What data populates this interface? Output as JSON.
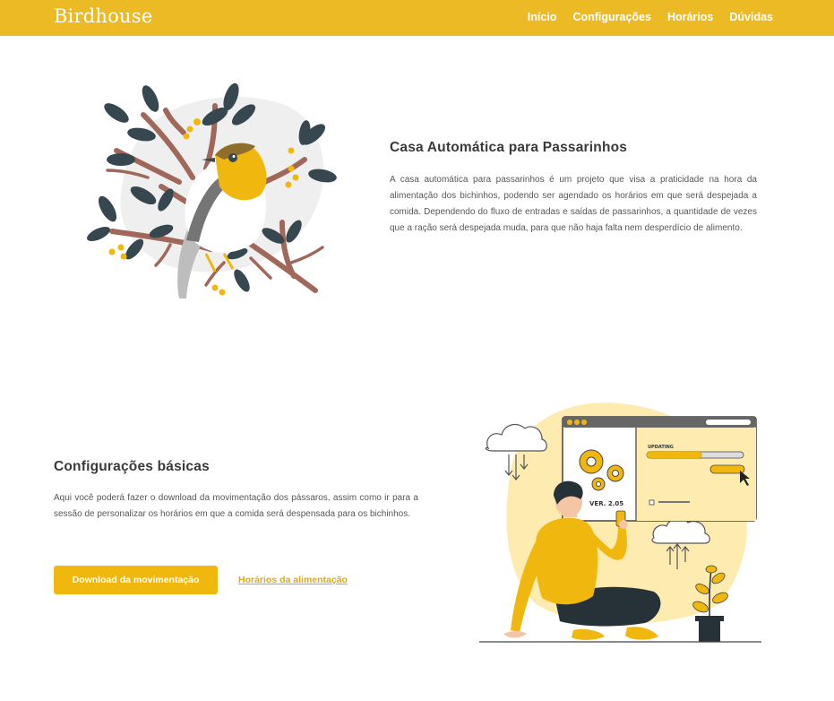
{
  "navbar": {
    "brand": "Birdhouse",
    "links": [
      "Início",
      "Configurações",
      "Horários",
      "Dúvidas"
    ]
  },
  "about": {
    "title": "Casa Automática para Passarinhos",
    "text": "A casa automática para passarinhos é um projeto que visa a praticidade na hora da alimentação dos bichinhos, podendo ser agendado os horários em que será despejada a comida. Dependendo do fluxo de entradas e saídas de passarinhos, a quantidade de vezes que a ração será despejada muda, para que não haja falta nem desperdício de alimento."
  },
  "config": {
    "title": "Configurações básicas",
    "text": "Aqui você poderá fazer o download da movimentação dos pássaros, assim como ir para a sessão de personalizar os horários em que a comida será despensada para os bichinhos.",
    "download_button": "Download da movimentação",
    "schedule_link": "Horários da alimentação"
  },
  "illustration": {
    "version_label": "VER. 2.05",
    "updating_label": "UPDATING"
  },
  "colors": {
    "accent": "#ecba24",
    "button": "#f0b70f",
    "link": "#e0a810",
    "leaf": "#37474f",
    "branch": "#a0685a"
  },
  "icons": [
    "bird-illustration",
    "gear-icon",
    "cloud-icon",
    "cursor-icon",
    "plant-icon"
  ]
}
